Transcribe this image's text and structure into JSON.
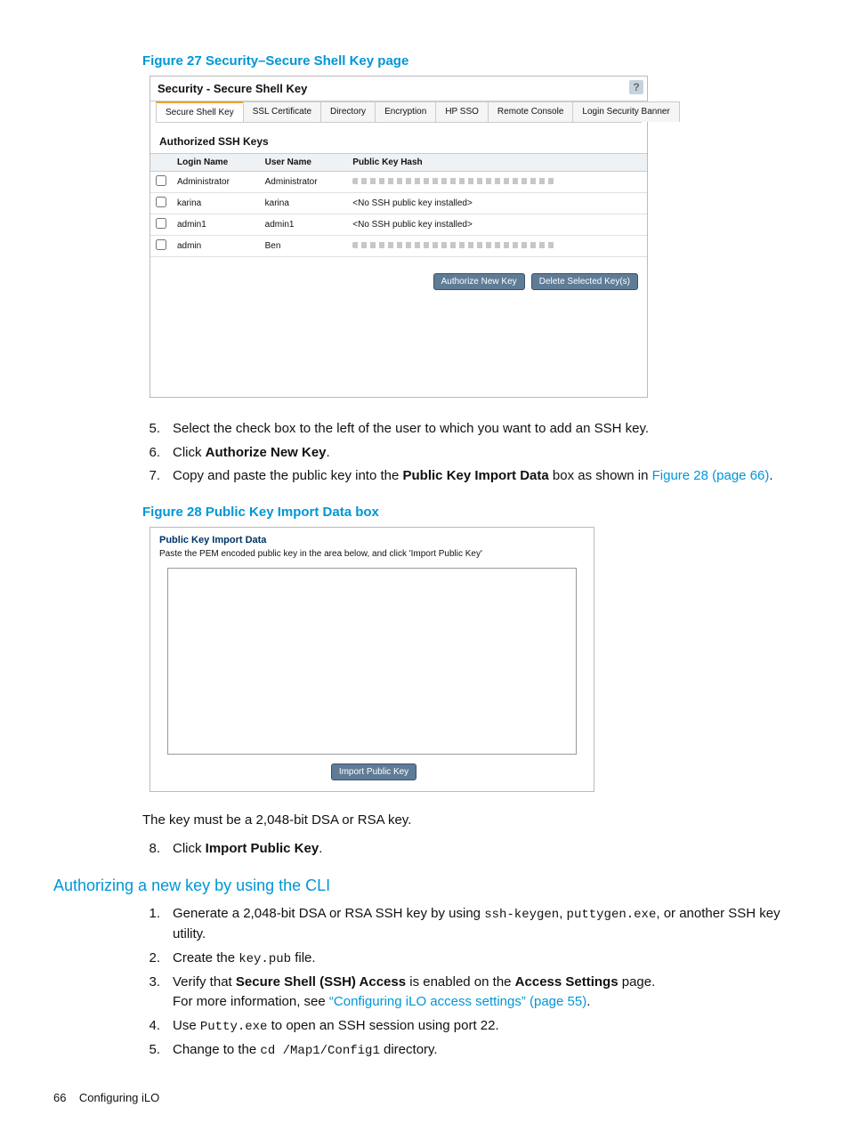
{
  "figure27": {
    "caption": "Figure 27 Security–Secure Shell Key page",
    "panel_title": "Security - Secure Shell Key",
    "help": "?",
    "tabs": [
      {
        "label": "Secure Shell Key",
        "active": true
      },
      {
        "label": "SSL Certificate",
        "active": false
      },
      {
        "label": "Directory",
        "active": false
      },
      {
        "label": "Encryption",
        "active": false
      },
      {
        "label": "HP SSO",
        "active": false
      },
      {
        "label": "Remote Console",
        "active": false
      },
      {
        "label": "Login Security Banner",
        "active": false
      }
    ],
    "section_title": "Authorized SSH Keys",
    "columns": {
      "login": "Login Name",
      "user": "User Name",
      "hash": "Public Key Hash"
    },
    "rows": [
      {
        "login": "Administrator",
        "user": "Administrator",
        "hash_type": "bar"
      },
      {
        "login": "karina",
        "user": "karina",
        "hash_type": "text",
        "hash": "<No SSH public key installed>"
      },
      {
        "login": "admin1",
        "user": "admin1",
        "hash_type": "text",
        "hash": "<No SSH public key installed>"
      },
      {
        "login": "admin",
        "user": "Ben",
        "hash_type": "bar"
      }
    ],
    "buttons": {
      "auth": "Authorize New Key",
      "del": "Delete Selected Key(s)"
    }
  },
  "steps_a": {
    "5": "Select the check box to the left of the user to which you want to add an SSH key.",
    "6_pre": "Click ",
    "6_b": "Authorize New Key",
    "6_post": ".",
    "7_pre": "Copy and paste the public key into the ",
    "7_b": "Public Key Import Data",
    "7_mid": " box as shown in ",
    "7_link": "Figure 28 (page 66)",
    "7_post": "."
  },
  "figure28": {
    "caption": "Figure 28 Public Key Import Data box",
    "title": "Public Key Import Data",
    "instr": "Paste the PEM encoded public key in the area below, and click 'Import Public Key'",
    "button": "Import Public Key"
  },
  "after28": {
    "line1": "The key must be a 2,048-bit DSA or RSA key.",
    "step8_pre": "Click ",
    "step8_b": "Import Public Key",
    "step8_post": "."
  },
  "cli": {
    "heading": "Authorizing a new key by using the CLI",
    "s1_pre": "Generate a 2,048-bit DSA or RSA SSH key by using ",
    "s1_c1": "ssh-keygen",
    "s1_mid1": ", ",
    "s1_c2": "puttygen.exe",
    "s1_post": ", or another SSH key utility.",
    "s2_pre": "Create the ",
    "s2_c": "key.pub",
    "s2_post": " file.",
    "s3_pre": "Verify that ",
    "s3_b1": "Secure Shell (SSH) Access",
    "s3_mid": " is enabled on the ",
    "s3_b2": "Access Settings",
    "s3_post": " page.",
    "s3b_pre": "For more information, see ",
    "s3b_link": "“Configuring iLO access settings” (page 55)",
    "s3b_post": ".",
    "s4_pre": "Use ",
    "s4_c": "Putty.exe",
    "s4_post": " to open an SSH session using port 22.",
    "s5_pre": "Change to the ",
    "s5_c": "cd /Map1/Config1",
    "s5_post": " directory."
  },
  "footer": {
    "page": "66",
    "title": "Configuring iLO"
  }
}
